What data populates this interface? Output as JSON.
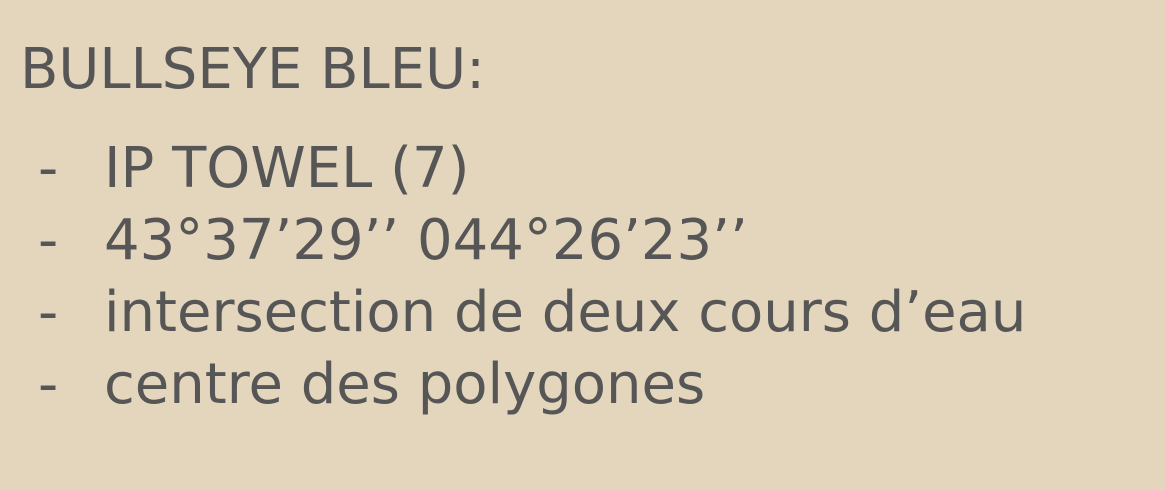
{
  "title": "BULLSEYE BLEU:",
  "bullet_marker": "-",
  "bullets": [
    "IP TOWEL (7)",
    "43°37’29’’ 044°26’23’’",
    "intersection de deux cours d’eau",
    "centre des polygones"
  ],
  "colors": {
    "background": "#e4d5bd",
    "text": "#565656"
  }
}
